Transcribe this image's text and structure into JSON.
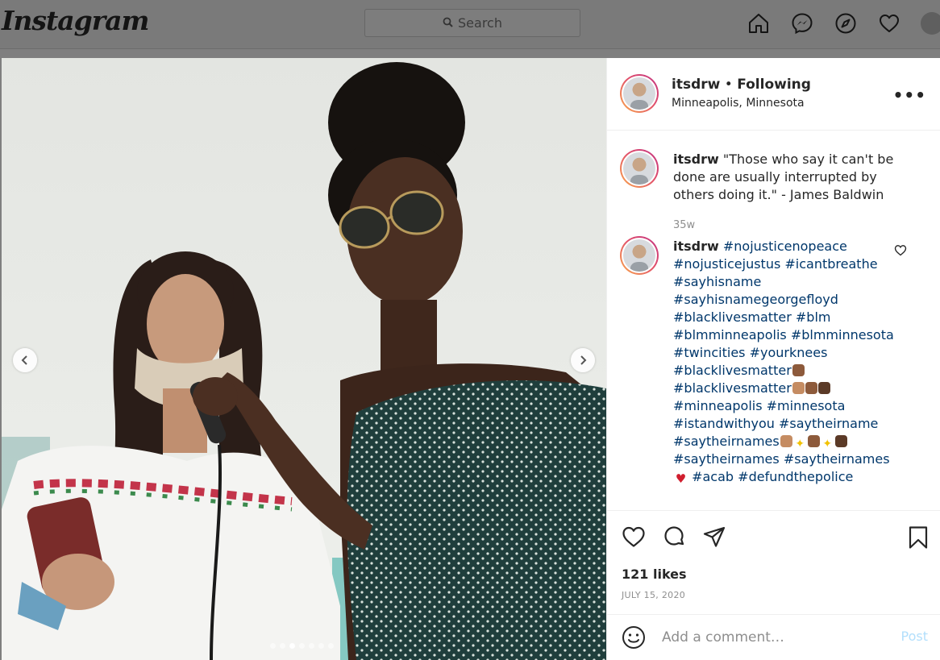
{
  "topbar": {
    "logo": "Instagram",
    "search_placeholder": "Search"
  },
  "post": {
    "username": "itsdrw",
    "separator": "•",
    "follow_status": "Following",
    "location": "Minneapolis, Minnesota",
    "more_label": "•••",
    "carousel": {
      "slides": 7,
      "active_index": 2
    },
    "caption": {
      "username": "itsdrw",
      "text": "\"Those who say it can't be done are usually interrupted by others doing it.\" - James Baldwin",
      "time": "35w"
    },
    "comment": {
      "username": "itsdrw",
      "tags": {
        "t1": "#nojusticenopeace",
        "t2": "#nojusticejustus",
        "t3": "#icantbreathe",
        "t4": "#sayhisname",
        "t5": "#sayhisnamegeorgefloyd",
        "t6": "#blacklivesmatter",
        "t7": "#blm",
        "t8": "#blmminneapolis",
        "t9": "#blmminnesota",
        "t10": "#twincities",
        "t11": "#yourknees",
        "t12": "#blacklivesmatter",
        "t13": "#blacklivesmatter",
        "t14": "#minneapolis",
        "t15": "#minnesota",
        "t16": "#istandwithyou",
        "t17": "#saytheirname",
        "t18": "#saytheirnames",
        "t19": "#saytheirnames",
        "t20": "#saytheirnames",
        "t21": "#acab",
        "t22": "#defundthepolice"
      }
    },
    "likes": "121 likes",
    "date": "JULY 15, 2020",
    "comment_placeholder": "Add a comment…",
    "post_button": "Post"
  },
  "icons": {
    "search": "search-icon",
    "home": "home-icon",
    "messenger": "messenger-icon",
    "explore": "compass-icon",
    "activity": "heart-icon",
    "like": "heart-icon",
    "comment": "comment-icon",
    "share": "paper-plane-icon",
    "save": "bookmark-icon",
    "emoji": "smiley-icon"
  },
  "colors": {
    "hashtag": "#00376b",
    "post_button": "#b2dffc",
    "muted": "#8e8e8e",
    "ring_start": "#f9a94b",
    "ring_end": "#c13584"
  }
}
